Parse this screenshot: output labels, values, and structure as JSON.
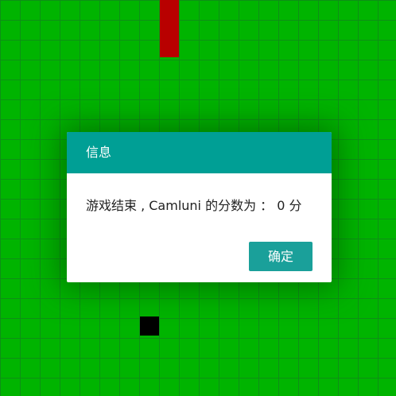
{
  "game": {
    "board_color": "#00b400",
    "grid_line_color": "#0e8f16",
    "snake_color": "#b80000",
    "food_color": "#000000"
  },
  "dialog": {
    "title": "信息",
    "message": "游戏结束 , Camluni 的分数为 ： 0 分",
    "confirm_label": "确定",
    "header_color": "#009f95",
    "button_color": "#1aa09a"
  }
}
